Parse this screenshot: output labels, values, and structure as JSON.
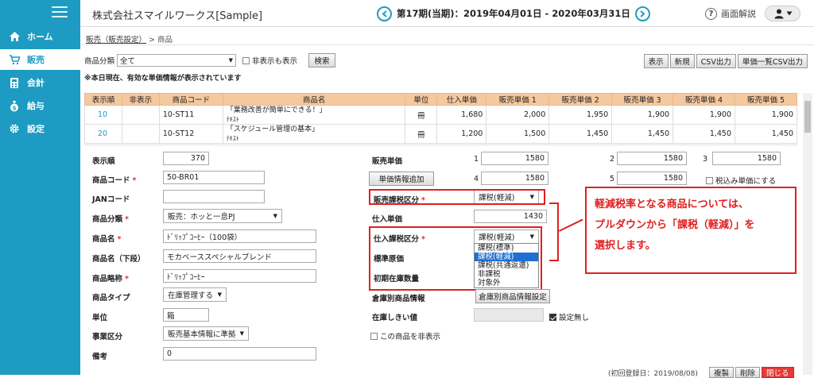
{
  "sidebar": {
    "items": [
      {
        "label": "ホーム",
        "icon": "home-icon"
      },
      {
        "label": "販売",
        "icon": "cart-icon"
      },
      {
        "label": "会計",
        "icon": "calculator-icon"
      },
      {
        "label": "給与",
        "icon": "money-bag-icon"
      },
      {
        "label": "設定",
        "icon": "gear-icon"
      }
    ]
  },
  "header": {
    "company": "株式会社スマイルワークス[Sample]",
    "period": "第17期(当期)：2019年04月01日 - 2020年03月31日",
    "help": "画面解説"
  },
  "breadcrumb": {
    "parent": "販売（販売設定）",
    "current": "> 商品"
  },
  "filter": {
    "category_label": "商品分類",
    "category_value": "全て",
    "show_hidden": "非表示も表示",
    "search": "検索"
  },
  "note": "※本日現在、有効な単価情報が表示されています",
  "actions": [
    "表示",
    "新規",
    "CSV出力",
    "単価一覧CSV出力"
  ],
  "table": {
    "headers": [
      "表示順",
      "非表示",
      "商品コード",
      "商品名",
      "単位",
      "仕入単価",
      "販売単価 1",
      "販売単価 2",
      "販売単価 3",
      "販売単価 4",
      "販売単価 5"
    ],
    "rows": [
      {
        "order": "10",
        "hidden": "",
        "code": "10-ST11",
        "name": "「業務改善が簡単にできる！」",
        "name_sub": "ﾃｷｽﾄ",
        "unit": "冊",
        "cost": "1,680",
        "p1": "2,000",
        "p2": "1,950",
        "p3": "1,900",
        "p4": "1,900",
        "p5": "1,900"
      },
      {
        "order": "20",
        "hidden": "",
        "code": "10-ST12",
        "name": "「スケジュール管理の基本」",
        "name_sub": "ﾃｷｽﾄ",
        "unit": "冊",
        "cost": "1,200",
        "p1": "1,500",
        "p2": "1,450",
        "p3": "1,450",
        "p4": "1,450",
        "p5": "1,450"
      }
    ]
  },
  "form": {
    "display_order": {
      "label": "表示順",
      "value": "370"
    },
    "product_code": {
      "label": "商品コード",
      "value": "50-BR01"
    },
    "jan": {
      "label": "JANコード",
      "value": ""
    },
    "category": {
      "label": "商品分類",
      "value": "販売：ホッと一息PJ"
    },
    "product_name": {
      "label": "商品名",
      "value": "ﾄﾞﾘｯﾌﾟｺｰﾋｰ（100袋）"
    },
    "product_name_lower": {
      "label": "商品名（下段）",
      "value": "モカベーススペシャルブレンド"
    },
    "short_name": {
      "label": "商品略称",
      "value": "ﾄﾞﾘｯﾌﾟｺｰﾋｰ"
    },
    "type": {
      "label": "商品タイプ",
      "value": "在庫管理する"
    },
    "unit": {
      "label": "単位",
      "value": "箱"
    },
    "business": {
      "label": "事業区分",
      "value": "販売基本情報に準拠"
    },
    "remarks": {
      "label": "備考",
      "value": "0"
    },
    "sales_price": {
      "label": "販売単価",
      "n1": "1",
      "v1": "1580",
      "n2": "2",
      "v2": "1580",
      "n3": "3",
      "v3": "1580",
      "n4": "4",
      "v4": "1580",
      "n5": "5",
      "v5": "1580"
    },
    "add_price_btn": "単価情報追加",
    "tax_included": "税込み単価にする",
    "sales_tax": {
      "label": "販売課税区分",
      "value": "課税(軽減)"
    },
    "purchase_price": {
      "label": "仕入単価",
      "value": "1430"
    },
    "purchase_tax": {
      "label": "仕入課税区分",
      "value": "課税(軽減)"
    },
    "standard_cost": {
      "label": "標準原価"
    },
    "initial_stock": {
      "label": "初期在庫数量"
    },
    "warehouse": {
      "label": "倉庫別商品情報",
      "button": "倉庫別商品情報設定"
    },
    "stock_threshold": {
      "label": "在庫しきい値",
      "no_setting": "設定無し"
    },
    "hide_product": "この商品を非表示"
  },
  "dropdown_options": [
    "課税(標準)",
    "課税(軽減)",
    "課税(共通返還)",
    "非課税",
    "対象外"
  ],
  "callout": [
    "軽減税率となる商品については、",
    "プルダウンから「課税（軽減）」を",
    "選択します。"
  ],
  "footer": {
    "reg_info": "(初回登録日：2019/08/08)",
    "buttons": [
      "複製",
      "削除",
      "閉じる"
    ]
  },
  "colors": {
    "sidebar": "#1e9bc2",
    "header_row": "#f5c99f",
    "annotation": "#e02020",
    "highlight": "#1e6fd4"
  }
}
